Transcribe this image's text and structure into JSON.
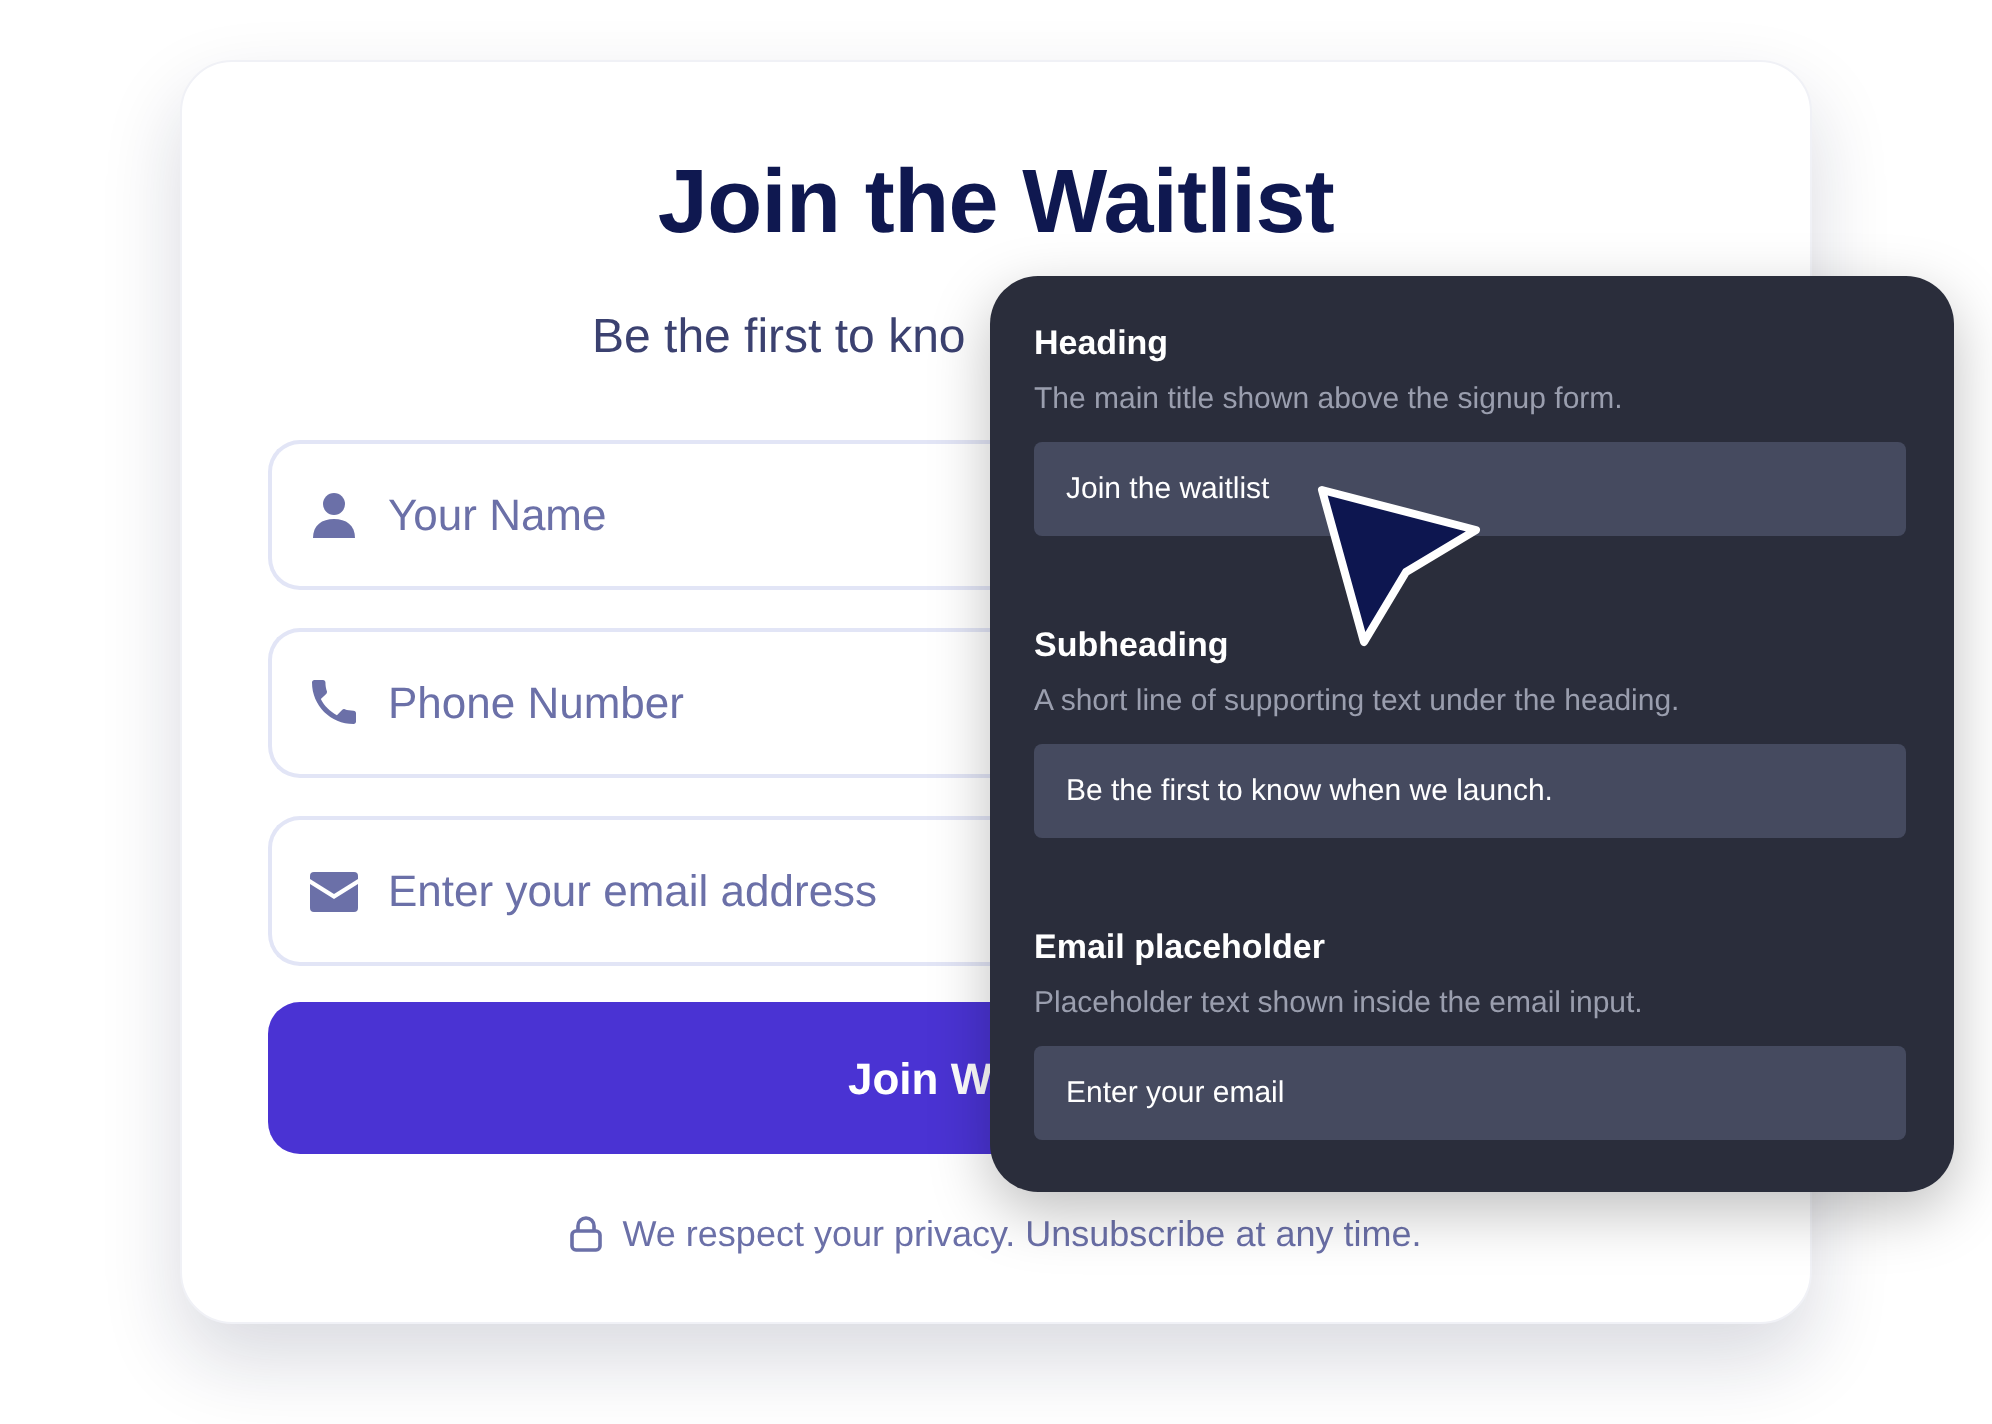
{
  "signup_card": {
    "title": "Join the Waitlist",
    "subtitle": "Be the first to kno",
    "fields": [
      {
        "kind": "name",
        "placeholder": "Your Name"
      },
      {
        "kind": "phone",
        "placeholder": "Phone Number"
      },
      {
        "kind": "email",
        "placeholder": "Enter your email address"
      }
    ],
    "submit_button": "Join W",
    "privacy_note": "We respect your privacy. Unsubscribe at any time."
  },
  "settings_panel": {
    "sections": [
      {
        "label": "Heading",
        "description": "The main title shown above the signup form.",
        "value": "Join the waitlist"
      },
      {
        "label": "Subheading",
        "description": "A short line of supporting text under the heading.",
        "value": "Be the first to know when we launch."
      },
      {
        "label": "Email placeholder",
        "description": "Placeholder text shown inside the email input.",
        "value": "Enter your email"
      }
    ]
  }
}
